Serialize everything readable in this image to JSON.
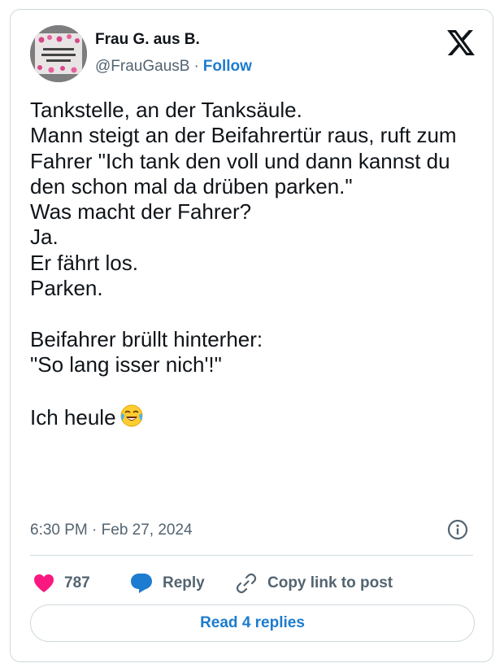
{
  "author": {
    "name": "Frau G. aus B.",
    "handle": "@FrauGausB",
    "separator": "·",
    "follow_label": "Follow"
  },
  "tweet": {
    "text": "Tankstelle, an der Tanksäule.\nMann steigt an der Beifahrertür raus, ruft zum Fahrer \"Ich tank den voll und dann kannst du den schon mal da drüben parken.\"\nWas macht der Fahrer?\nJa.\nEr fährt los.\nParken.\n\nBeifahrer brüllt hinterher:\n\"So lang isser nich'!\"\n\nIch heule",
    "emoji": "face-with-tears-of-joy",
    "timestamp": "6:30 PM · Feb 27, 2024"
  },
  "actions": {
    "likes": "787",
    "reply_label": "Reply",
    "copy_label": "Copy link to post"
  },
  "read_replies_label": "Read 4 replies",
  "colors": {
    "accent": "#1d7ccf",
    "like": "#f91880",
    "muted": "#536471",
    "border": "#cfd9de"
  },
  "icons": [
    "x-logo-icon",
    "info-icon",
    "heart-icon",
    "reply-bubble-icon",
    "link-icon",
    "laughing-emoji-icon"
  ]
}
